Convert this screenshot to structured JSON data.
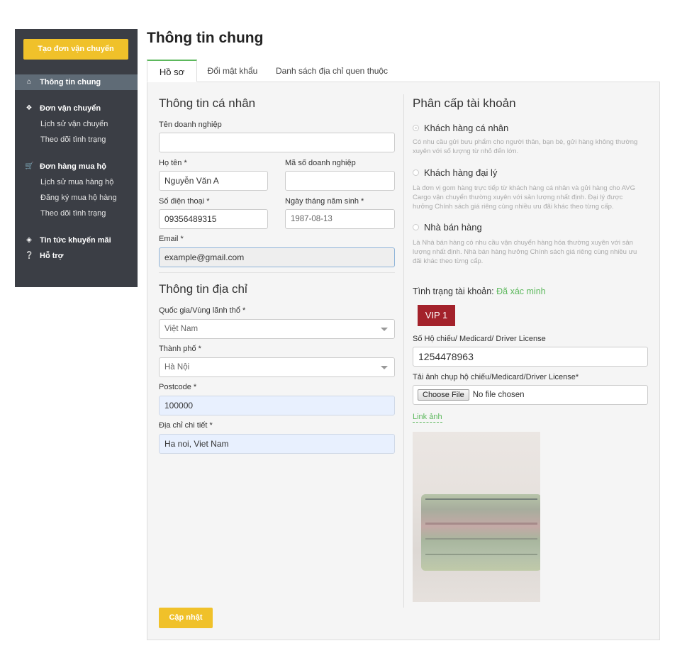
{
  "sidebar": {
    "create_button": "Tạo đơn vận chuyển",
    "items": [
      {
        "label": "Thông tin chung",
        "icon": "home-icon"
      },
      {
        "label": "Đơn vận chuyển",
        "icon": "dropbox-icon"
      },
      {
        "label": "Đơn hàng mua hộ",
        "icon": "cart-icon"
      },
      {
        "label": "Tin tức khuyến mãi",
        "icon": "tags-icon"
      },
      {
        "label": "Hỗ trợ",
        "icon": "question-circle-icon"
      }
    ],
    "shipping_sub": [
      "Lịch sử vận chuyển",
      "Theo dõi tình trạng"
    ],
    "purchase_sub": [
      "Lịch sử mua hàng hộ",
      "Đăng ký mua hộ hàng",
      "Theo dõi tình trạng"
    ]
  },
  "page_title": "Thông tin chung",
  "tabs": [
    {
      "label": "Hồ sơ",
      "active": true
    },
    {
      "label": "Đổi mật khẩu",
      "active": false
    },
    {
      "label": "Danh sách địa chỉ quen thuộc",
      "active": false
    }
  ],
  "personal": {
    "heading": "Thông tin cá nhân",
    "company_label": "Tên doanh nghiệp",
    "company_value": "",
    "name_label": "Họ tên *",
    "name_value": "Nguyễn Văn A",
    "tax_label": "Mã số doanh nghiệp",
    "tax_value": "",
    "phone_label": "Số điện thoại *",
    "phone_value": "09356489315",
    "dob_label": "Ngày tháng năm sinh *",
    "dob_value": "1987-08-13",
    "email_label": "Email *",
    "email_value": "example@gmail.com"
  },
  "address": {
    "heading": "Thông tin địa chỉ",
    "country_label": "Quốc gia/Vùng lãnh thổ *",
    "country_value": "Việt Nam",
    "city_label": "Thành phố *",
    "city_value": "Hà Nội",
    "postcode_label": "Postcode *",
    "postcode_value": "100000",
    "detail_label": "Địa chỉ chi tiết *",
    "detail_value": "Ha noi, Viet Nam"
  },
  "account": {
    "heading": "Phân cấp tài khoản",
    "options": [
      {
        "label": "Khách hàng cá nhân",
        "checked": true,
        "desc": "Có nhu cầu gửi bưu phẩm cho người thân, bạn bè, gửi hàng không thường xuyên với số lượng từ nhỏ đến lớn."
      },
      {
        "label": "Khách hàng đại lý",
        "checked": false,
        "desc": "Là đơn vị gom hàng trực tiếp từ khách hàng cá nhân và gửi hàng cho AVG Cargo vận chuyển thường xuyên với sản lượng nhất định. Đại lý được hưởng Chính sách giá riêng cùng nhiều ưu đãi khác theo từng cấp."
      },
      {
        "label": "Nhà bán hàng",
        "checked": false,
        "desc": "Là Nhà bán hàng có nhu cầu vận chuyển hàng hóa thường xuyên với sản lượng nhất định. Nhà bán hàng hưởng Chính sách giá riêng cùng nhiều ưu đãi khác theo từng cấp."
      }
    ],
    "status_label": "Tình trạng tài khoản:",
    "status_value": "Đã xác minh",
    "vip_badge": "VIP 1",
    "passport_label": "Số Hộ chiếu/ Medicard/ Driver License",
    "passport_value": "1254478963",
    "upload_label": "Tải ảnh chụp hộ chiếu/Medicard/Driver License*",
    "choose_file": "Choose File",
    "no_file": "No file chosen",
    "link_label": "Link ảnh"
  },
  "update_button": "Cập nhật",
  "colors": {
    "accent": "#f0c12a",
    "sidebar": "#3b3e45",
    "success": "#5cb85c",
    "vip": "#a3222b"
  }
}
